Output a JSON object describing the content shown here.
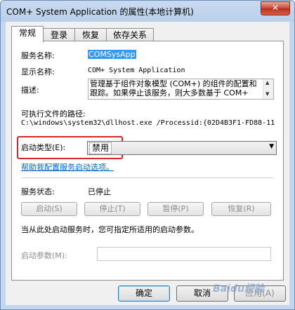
{
  "window": {
    "title": "COM+ System Application 的属性(本地计算机)",
    "close_label": "✕"
  },
  "tabs": [
    {
      "label": "常规",
      "active": true
    },
    {
      "label": "登录",
      "active": false
    },
    {
      "label": "恢复",
      "active": false
    },
    {
      "label": "依存关系",
      "active": false
    }
  ],
  "general": {
    "service_name_label": "服务名称:",
    "service_name_value": "COMSysApp",
    "display_name_label": "显示名称:",
    "display_name_value": "COM+ System Application",
    "description_label": "描述:",
    "description_value": "管理基于组件对象模型 (COM+) 的组件的配置和跟踪。如果停止该服务，则大多数基于 COM+",
    "exe_path_label": "可执行文件的路径:",
    "exe_path_value": "C:\\windows\\system32\\dllhost.exe /Processid:{02D4B3F1-FD88-11",
    "startup_type_label": "启动类型(E):",
    "startup_type_value": "禁用",
    "help_link": "帮助我配置服务启动选项。",
    "service_status_label": "服务状态:",
    "service_status_value": "已停止",
    "buttons": {
      "start": "启动(S)",
      "stop": "停止(T)",
      "pause": "暂停(P)",
      "resume": "恢复(R)"
    },
    "start_params_hint": "当从此处启动服务时，您可指定所适用的启动参数。",
    "start_params_label": "启动参数(M):",
    "start_params_value": ""
  },
  "footer": {
    "ok": "确定",
    "cancel": "取消",
    "apply": "应用(A)"
  },
  "watermark": "Baidu经验",
  "colors": {
    "highlight_box": "#d9262b",
    "selection": "#3399ff",
    "link": "#0066cc"
  }
}
